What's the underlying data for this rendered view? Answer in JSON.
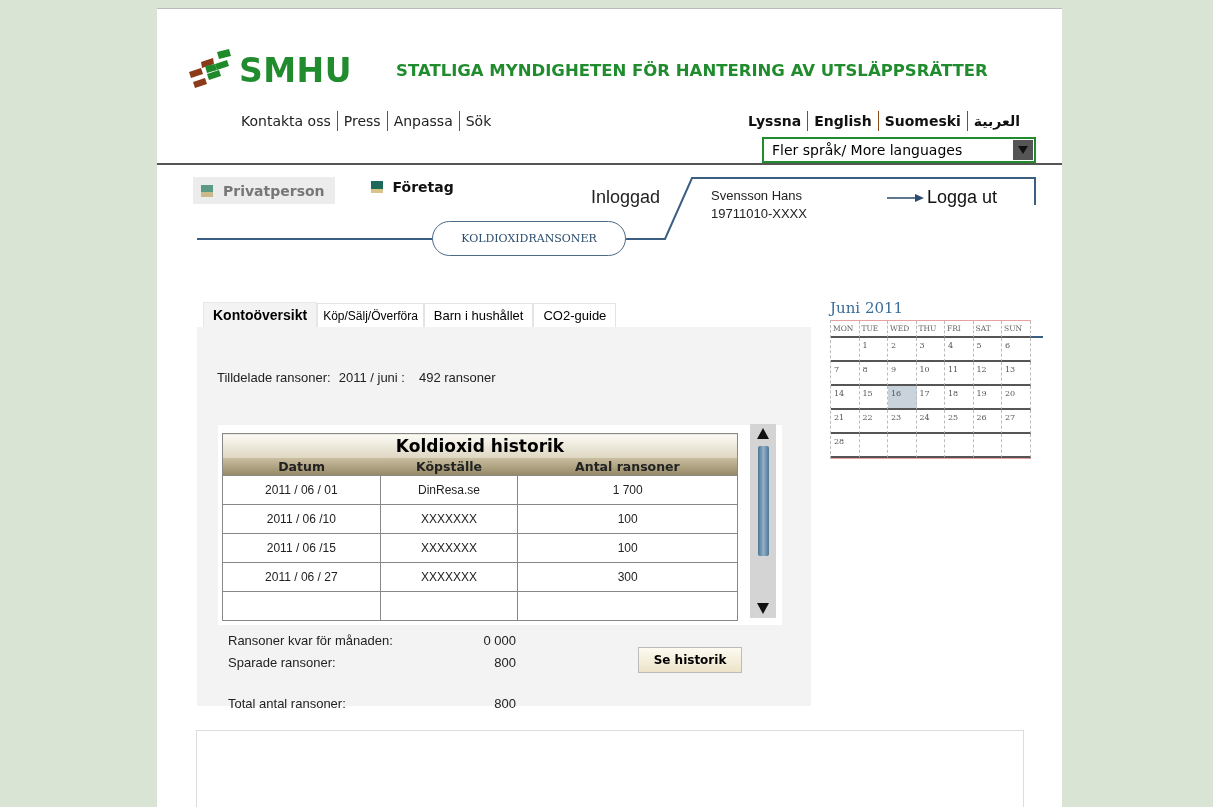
{
  "header": {
    "logo_text": "SMHU",
    "agency_name": "STATLIGA MYNDIGHETEN FÖR HANTERING AV UTSLÄPPSRÄTTER"
  },
  "nav_links": [
    "Kontakta oss",
    "Press",
    "Anpassa",
    "Sök"
  ],
  "language_links": [
    "Lyssna",
    "English",
    "Suomeski",
    "العربية"
  ],
  "language_select": {
    "value": "Fler språk/ More languages"
  },
  "audience_tabs": [
    {
      "label": "Privatperson",
      "selected": true
    },
    {
      "label": "Företag",
      "selected": false
    }
  ],
  "section_label": "KOLDIOXIDRANSONER",
  "login": {
    "status": "Inloggad",
    "name": "Svensson Hans",
    "id": "19711010-XXXX",
    "logout": "Logga ut"
  },
  "tabs": [
    {
      "label": "Kontoöversikt",
      "selected": true
    },
    {
      "label": "Köp/Sälj/Överföra",
      "selected": false
    },
    {
      "label": "Barn i hushållet",
      "selected": false
    },
    {
      "label": "CO2-guide",
      "selected": false
    }
  ],
  "allocation": {
    "label": "Tilldelade ransoner:",
    "period": "2011 / juni :",
    "amount": "492 ransoner"
  },
  "history_table": {
    "title": "Koldioxid historik",
    "columns": [
      "Datum",
      "Köpställe",
      "Antal ransoner"
    ],
    "rows": [
      [
        "2011 / 06 / 01",
        "DinResa.se",
        "1 700"
      ],
      [
        "2011 / 06 /10",
        "XXXXXXX",
        "100"
      ],
      [
        "2011 / 06 /15",
        "XXXXXXX",
        "100"
      ],
      [
        "2011 / 06 / 27",
        "XXXXXXX",
        "300"
      ]
    ]
  },
  "summary": [
    {
      "label": "Ransoner kvar för månaden:",
      "value": "0 000"
    },
    {
      "label": "Sparade ransoner:",
      "value": "800"
    },
    {
      "label": "Total antal ransoner:",
      "value": "800"
    }
  ],
  "history_button": "Se historik",
  "calendar": {
    "title": "Juni 2011",
    "weekdays": [
      "MON",
      "TUE",
      "WED",
      "THU",
      "FRI",
      "SAT",
      "SUN"
    ],
    "weeks": [
      [
        {
          "day": "1",
          "selected": false
        },
        {
          "day": "2",
          "selected": false
        },
        {
          "day": "3",
          "selected": false
        },
        {
          "day": "4",
          "selected": false
        },
        {
          "day": "5",
          "selected": false
        },
        {
          "day": "6",
          "selected": false
        }
      ],
      [
        {
          "day": "7",
          "selected": false
        },
        {
          "day": "8",
          "selected": false
        },
        {
          "day": "9",
          "selected": false
        },
        {
          "day": "10",
          "selected": false
        },
        {
          "day": "11",
          "selected": false
        },
        {
          "day": "12",
          "selected": false
        },
        {
          "day": "13",
          "selected": false
        }
      ],
      [
        {
          "day": "14",
          "selected": false
        },
        {
          "day": "15",
          "selected": false
        },
        {
          "day": "16",
          "selected": true
        },
        {
          "day": "17",
          "selected": false
        },
        {
          "day": "18",
          "selected": false
        },
        {
          "day": "19",
          "selected": false
        },
        {
          "day": "20",
          "selected": false
        }
      ],
      [
        {
          "day": "21",
          "selected": false
        },
        {
          "day": "22",
          "selected": false
        },
        {
          "day": "23",
          "selected": false
        },
        {
          "day": "24",
          "selected": false
        },
        {
          "day": "25",
          "selected": false
        },
        {
          "day": "26",
          "selected": false
        },
        {
          "day": "27",
          "selected": false
        }
      ],
      [
        {
          "day": "28",
          "selected": false
        }
      ]
    ]
  }
}
